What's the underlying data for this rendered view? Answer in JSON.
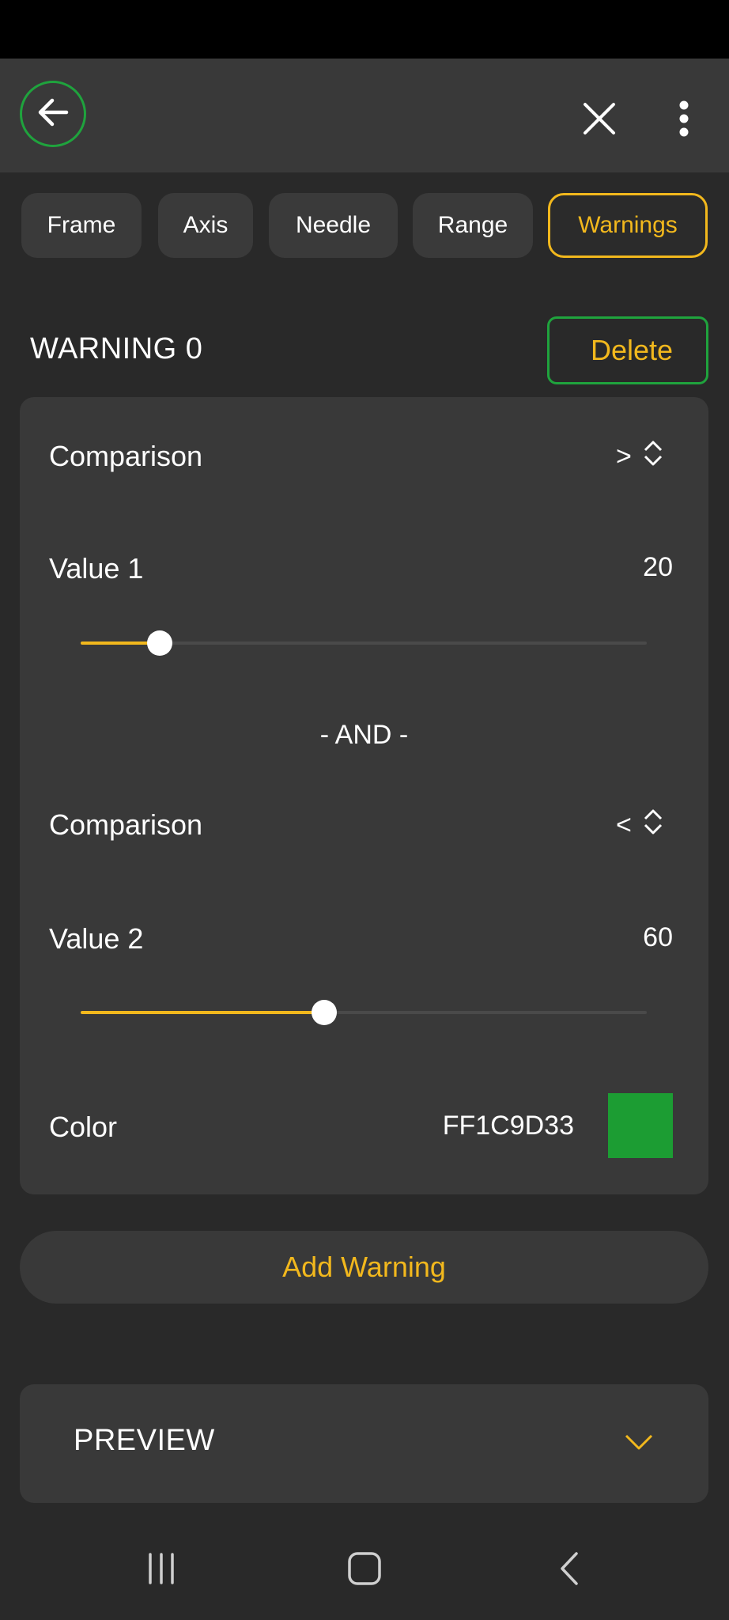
{
  "colors": {
    "accent": "#f2b81d",
    "green": "#1fa33d",
    "swatch": "#1c9d33"
  },
  "icons": {
    "back": "arrow-left-icon",
    "close": "close-icon",
    "more": "more-vertical-icon",
    "select": "chevron-up-down-icon",
    "expand": "chevron-down-icon",
    "nav_recents": "recents-icon",
    "nav_home": "home-icon",
    "nav_back": "nav-back-icon"
  },
  "tabs": [
    {
      "label": "Frame"
    },
    {
      "label": "Axis"
    },
    {
      "label": "Needle"
    },
    {
      "label": "Range"
    },
    {
      "label": "Warnings",
      "active": true
    }
  ],
  "warning": {
    "title": "WARNING 0",
    "delete_label": "Delete",
    "comparison1_label": "Comparison",
    "comparison1_value": ">",
    "value1_label": "Value 1",
    "value1": "20",
    "value1_fraction": 0.14,
    "and_label": "- AND -",
    "comparison2_label": "Comparison",
    "comparison2_value": "<",
    "value2_label": "Value 2",
    "value2": "60",
    "value2_fraction": 0.43,
    "color_label": "Color",
    "color_hex": "FF1C9D33"
  },
  "add_warning_label": "Add Warning",
  "preview": {
    "title": "PREVIEW"
  }
}
